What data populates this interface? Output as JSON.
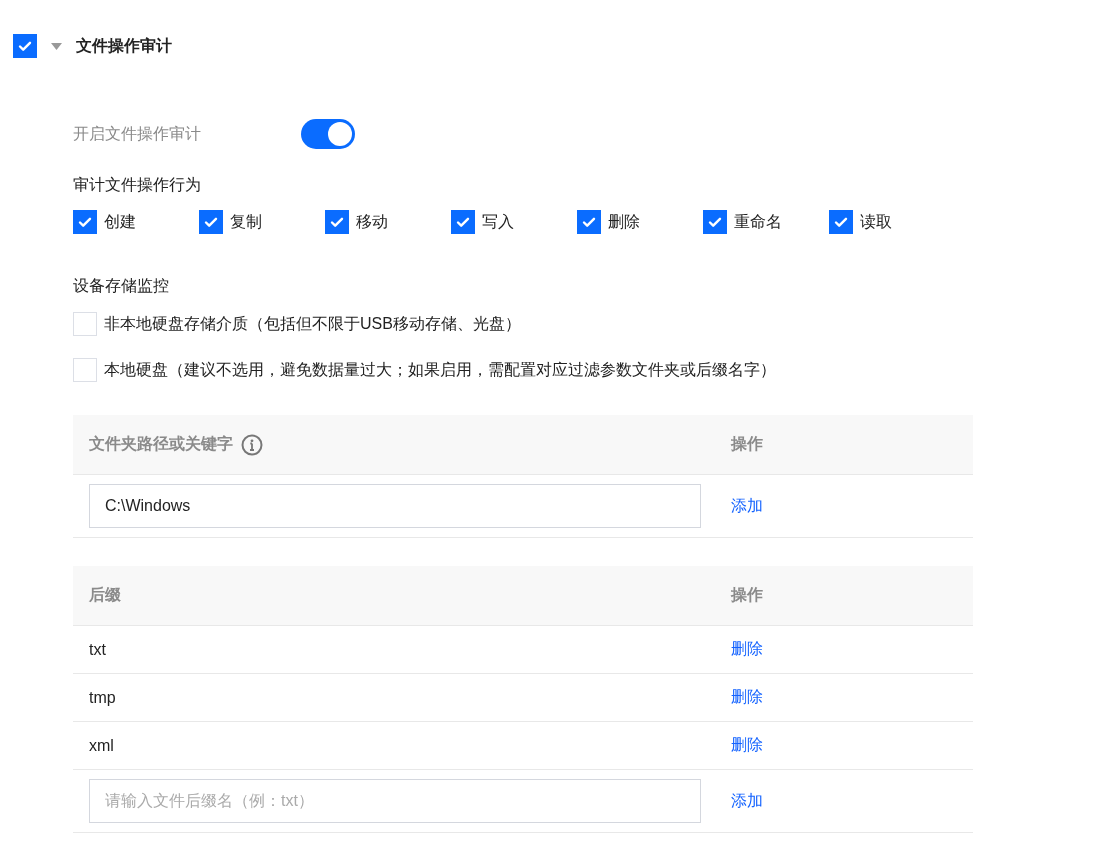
{
  "section": {
    "title": "文件操作审计",
    "checked": true,
    "expanded": true
  },
  "enable": {
    "label": "开启文件操作审计",
    "on": true
  },
  "operations": {
    "title": "审计文件操作行为",
    "items": [
      {
        "label": "创建",
        "checked": true
      },
      {
        "label": "复制",
        "checked": true
      },
      {
        "label": "移动",
        "checked": true
      },
      {
        "label": "写入",
        "checked": true
      },
      {
        "label": "删除",
        "checked": true
      },
      {
        "label": "重命名",
        "checked": true
      },
      {
        "label": "读取",
        "checked": true
      }
    ]
  },
  "storage": {
    "title": "设备存储监控",
    "options": [
      {
        "label": "非本地硬盘存储介质（包括但不限于USB移动存储、光盘）",
        "checked": false
      },
      {
        "label": "本地硬盘（建议不选用，避免数据量过大；如果启用，需配置对应过滤参数文件夹或后缀名字）",
        "checked": false
      }
    ]
  },
  "folder_table": {
    "columns": [
      "文件夹路径或关键字",
      "操作"
    ],
    "input": {
      "value": "C:\\Windows"
    },
    "action": "添加"
  },
  "suffix_table": {
    "columns": [
      "后缀",
      "操作"
    ],
    "rows": [
      {
        "suffix": "txt",
        "action": "删除"
      },
      {
        "suffix": "tmp",
        "action": "删除"
      },
      {
        "suffix": "xml",
        "action": "删除"
      }
    ],
    "input": {
      "placeholder": "请输入文件后缀名（例：txt）"
    },
    "action": "添加"
  }
}
